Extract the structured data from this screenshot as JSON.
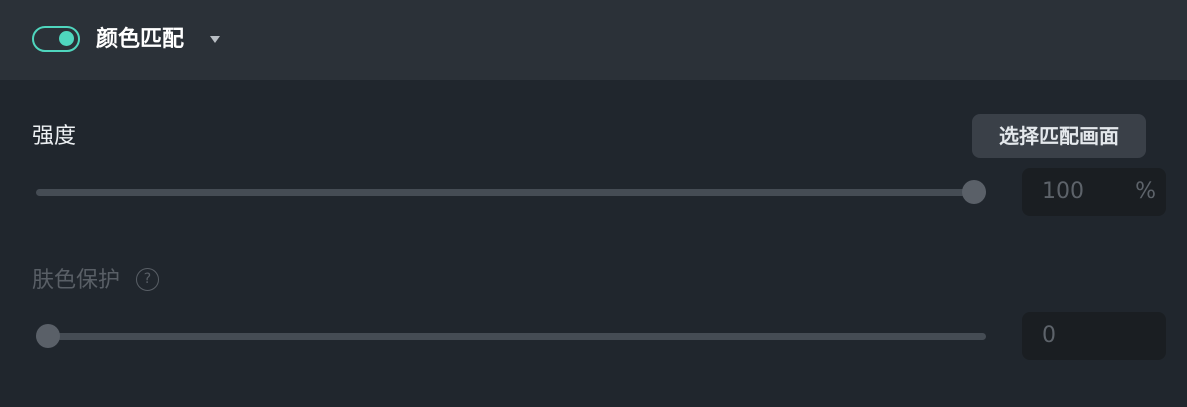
{
  "header": {
    "enabled": true,
    "title": "颜色匹配"
  },
  "strength": {
    "label": "强度",
    "value": "100",
    "unit": "%",
    "level": 1.0
  },
  "match_button": {
    "label": "选择匹配画面"
  },
  "skin_protect": {
    "label": "肤色保护",
    "help_icon": "?",
    "value": "0",
    "level": 0.0
  },
  "colors": {
    "accent": "#4fd6be",
    "background": "#20262d",
    "header_background": "#2b3138"
  },
  "icons": {
    "toggle": "toggle-switch-icon",
    "dropdown": "caret-down-icon",
    "help": "question-circle-icon"
  }
}
